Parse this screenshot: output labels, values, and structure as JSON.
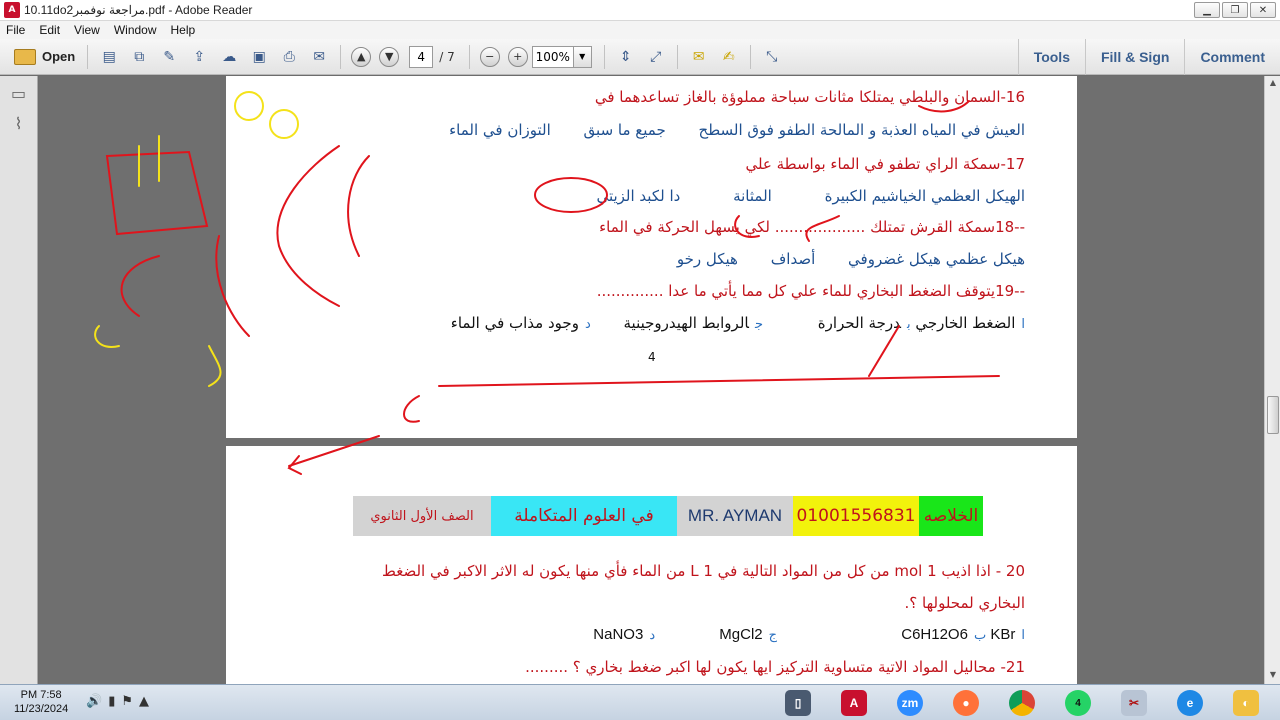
{
  "window": {
    "title": "مراجعة نوفمبر2.pdf - Adobe Reader",
    "title_prefix": "10.11do",
    "app_icon": "pdf-icon"
  },
  "menu": [
    "File",
    "Edit",
    "View",
    "Window",
    "Help"
  ],
  "toolbar": {
    "open_label": "Open",
    "current_page": "4",
    "total_pages": "/ 7",
    "zoom": "100%",
    "tools_label": "Tools",
    "fill_sign_label": "Fill & Sign",
    "comment_label": "Comment"
  },
  "page1": {
    "q16": "16-السمان والبلطي يمتلكا مثانات سباحة مملوؤة بالغاز تساعدهما في",
    "q16_options": [
      "العيش في المياه العذبة و المالحة",
      "الطفو فوق السطح",
      "جميع ما سبق",
      "التوزان في الماء"
    ],
    "q17": "17-سمكة الراي تطفو في الماء بواسطة  علي",
    "q17_options": [
      "الهيكل العظمي",
      "الخياشيم الكبيرة",
      "المثانة",
      "دا لكبد الزيتي"
    ],
    "q18": "--18سمكة القرش تمتلك ................... لكي يسهل الحركة في الماء",
    "q18_options": [
      "هيكل عظمي",
      "هيكل غضروفي",
      "أصداف",
      "هيكل رخو"
    ],
    "q19": "--19يتوقف الضغط البخاري للماء علي كل مما يأتي ما عدا ..............",
    "q19_options": [
      {
        "letter": "ا",
        "text": "الضغط الخارجي"
      },
      {
        "letter": "ب",
        "text": "درجة الحرارة"
      },
      {
        "letter": "ج",
        "text": "الروابط الهيدروجينية"
      },
      {
        "letter": "د",
        "text": "وجود مذاب في الماء"
      }
    ],
    "page_number": "4"
  },
  "page2": {
    "band": {
      "summary": "الخلاصه",
      "phone": "01001556831",
      "name": "MR. AYMAN",
      "science": "في  العلوم المتكاملة",
      "grade": "الصف الأول الثانوي"
    },
    "q20_line1": "20 - اذا اذيب  1 mol من كل من المواد التالية في L 1 من الماء فأي منها يكون له الاثر الاكبر في الضغط",
    "q20_line2": "البخاري لمحلولها ؟.",
    "q20_options": [
      {
        "letter": "ا",
        "text": "KBr"
      },
      {
        "letter": "ب",
        "text": "C6H12O6"
      },
      {
        "letter": "ج",
        "text": "MgCl2"
      },
      {
        "letter": "د",
        "text": "NaNO3"
      }
    ],
    "q21": "21- محاليل المواد الاتية متساوية التركيز ايها يكون لها اكبر ضغط بخاري ؟ ........."
  },
  "taskbar": {
    "time": "PM 7:58",
    "date": "11/23/2024",
    "apps": [
      "phone-icon",
      "acrobat-icon",
      "zoom-icon",
      "firefox-icon",
      "chrome-icon",
      "whatsapp-icon",
      "snipping-icon",
      "ie-icon",
      "paint-icon"
    ],
    "whatsapp_badge": "4",
    "zoom_label": "zm"
  },
  "colors": {
    "question_red": "#c0141c",
    "option_blue": "#1e4f8f",
    "ink_red": "#e0141c",
    "ink_yellow": "#f4e21a"
  }
}
